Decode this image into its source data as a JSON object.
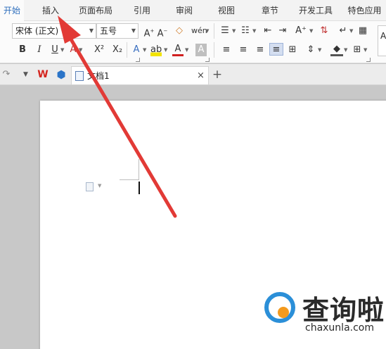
{
  "menu": {
    "tabs": [
      "开始",
      "插入",
      "页面布局",
      "引用",
      "审阅",
      "视图",
      "章节",
      "开发工具",
      "特色应用"
    ],
    "active_index": 0
  },
  "ribbon": {
    "font_name": "宋体 (正文)",
    "font_size": "五号",
    "style_preview": "A",
    "pinyin_label": "wén"
  },
  "doc": {
    "tab_title": "文档1",
    "close_glyph": "×",
    "new_tab_glyph": "+"
  },
  "watermark": {
    "text": "查询啦",
    "url": "chaxunla.com"
  },
  "colors": {
    "accent": "#2f6fbd",
    "arrow": "#e23a36",
    "wps_red": "#d4251f",
    "watermark_blue": "#2b8fd8",
    "watermark_orange": "#f39a1e"
  }
}
